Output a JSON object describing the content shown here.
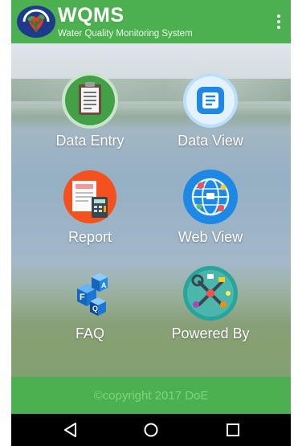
{
  "app": {
    "title": "WQMS",
    "subtitle": "Water Quality Monitoring System",
    "overflow_icon": "more-vertical-icon"
  },
  "menu": [
    {
      "id": "data-entry",
      "label": "Data Entry",
      "icon": "clipboard-icon",
      "color": "#43a047"
    },
    {
      "id": "data-view",
      "label": "Data View",
      "icon": "document-view-icon",
      "color": "#1e88e5"
    },
    {
      "id": "report",
      "label": "Report",
      "icon": "report-calculator-icon",
      "color": "#f4511e"
    },
    {
      "id": "web-view",
      "label": "Web View",
      "icon": "globe-network-icon",
      "color": "#1e88e5"
    },
    {
      "id": "faq",
      "label": "FAQ",
      "icon": "faq-cubes-icon",
      "color": "#1565c0"
    },
    {
      "id": "powered-by",
      "label": "Powered By",
      "icon": "tools-icon",
      "color": "#26a69a"
    }
  ],
  "footer": {
    "copyright": "©copyright 2017 DoE"
  },
  "system_nav": {
    "back": "back-icon",
    "home": "home-icon",
    "recents": "recents-icon"
  },
  "colors": {
    "primary": "#4caf50",
    "footer_text": "#7bd67f",
    "nav_bar": "#000000"
  }
}
